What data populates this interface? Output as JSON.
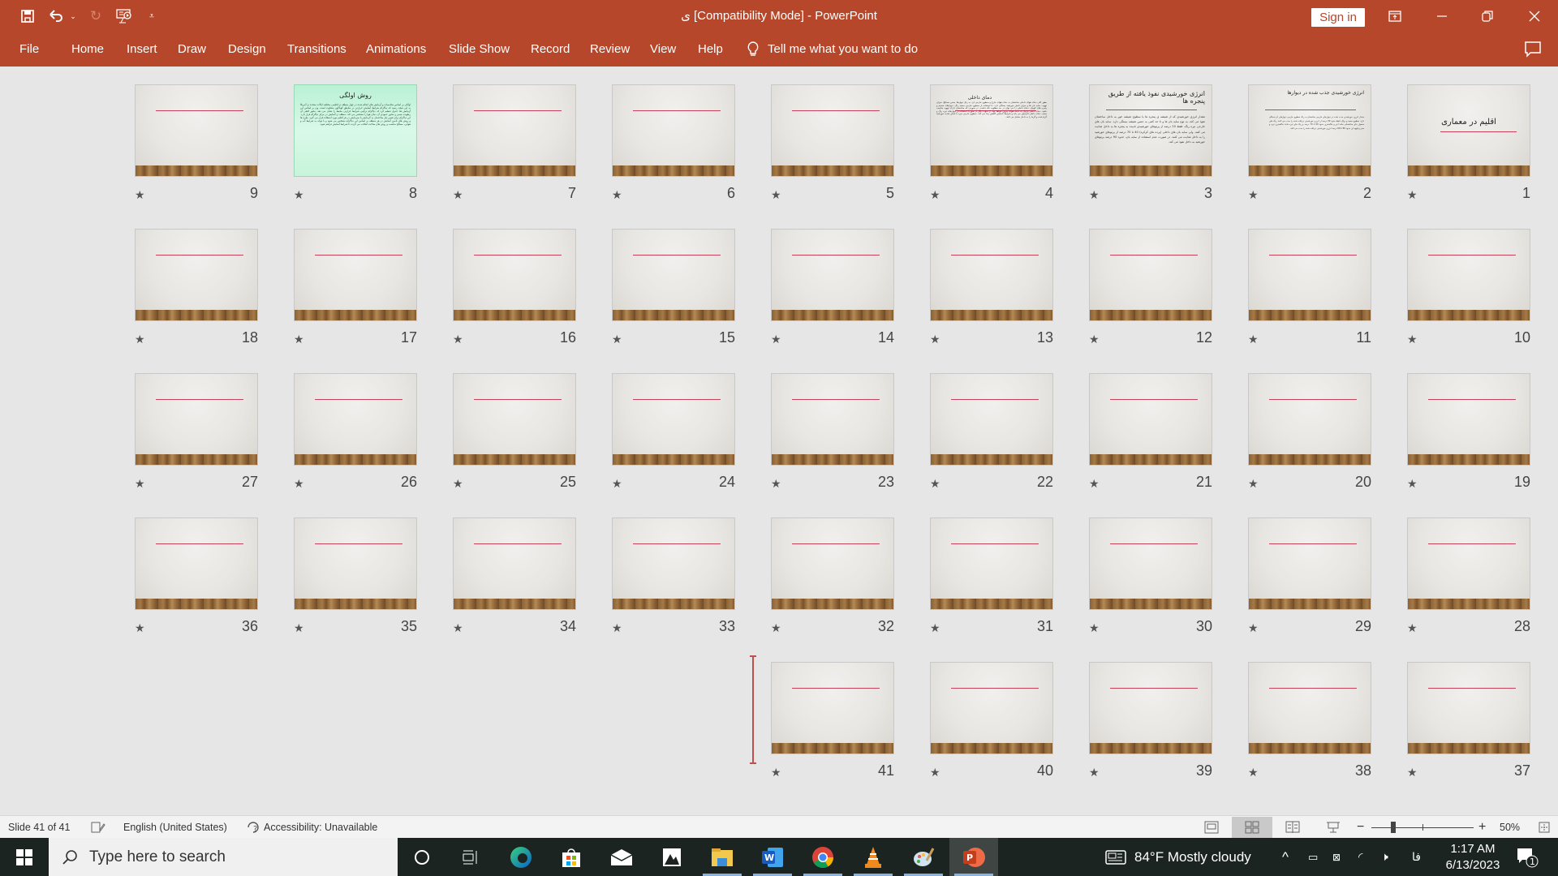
{
  "app": {
    "title": "ی [Compatibility Mode]  -  PowerPoint",
    "sign_in": "Sign in",
    "colors": {
      "brand": "#b7472a",
      "accent_line": "#c4425a",
      "selected_view": "#c9c9c9"
    }
  },
  "quick_access": {
    "icons": [
      "save-icon",
      "undo-icon",
      "undo-dropdown-icon",
      "redo-icon",
      "start-from-beginning-icon",
      "customize-qat-icon"
    ]
  },
  "window_controls": [
    "ribbon-display-options-icon",
    "minimize-icon",
    "restore-icon",
    "close-icon"
  ],
  "ribbon": {
    "tabs": [
      "File",
      "Home",
      "Insert",
      "Draw",
      "Design",
      "Transitions",
      "Animations",
      "Slide Show",
      "Record",
      "Review",
      "View",
      "Help"
    ],
    "tell_me": "Tell me what you want to do"
  },
  "slides": [
    {
      "number": "1",
      "kind": "title",
      "title": "اقلیم در معماری"
    },
    {
      "number": "2",
      "kind": "text",
      "title": "انرژی خورشیدی جذب شده در دیوارها",
      "body": "مقدار انرژی خورشیدی جذب شده در دیوارهای خارجی ساختمان به رنگ سطوح خارجی دیوارهای آن بستگی دارد. سطوح سفید و براق، فقط حدود 20 درصد از انرژی خورشیدی دریافت شده را جذب می کنند. رنگ های معمول بنای ساختمانی مانند آجر و خاکستری حدود 60 تا 70 درصد و رنگ های تیره مانند خاکستری تیره و سبز و قهوه ای حدود 80 تا 90 درصد انرژی خورشیدی دریافت شده را جذب می کنند."
    },
    {
      "number": "3",
      "kind": "text",
      "title": "انرژی خورشیدی نفوذ یافته از طریق پنجره ها",
      "body": "مقدار انرژی خورشیدی که از شیشه ی پنجره ها یا سطوح شیشه خور به داخل ساختمان نفوذ می کند، به نوع سایه بان ها و تا حد کمی به جنس شیشه بستگی دارد. سایه بان های خارجی تیره رنگ، فقط 10 درصد از پرتوهای خورشیدی تابیده به پنجره ها به داخل هدایت می کنند. ولی سایه بان های داخلی (پرده های کرکره) 40 تا 70 درصد از پرتوهای خورشید را به داخل هدایت می کنند. در صورت عدم استفاده از سایه بان، حدود 90 درصد پرتوهای خورشید به داخل نفوذ می کند."
    },
    {
      "number": "4",
      "kind": "dense",
      "title": "دمای داخلی",
      "body": "بطور کلی دمای هوای داخلی ساختمان به دمای هوای خارج و سطوح خارجی آن، به رنگ دیوارها، جنس مصالح، میزان تهویه، سایه بان ها و میزان تابش خورشید بستگی دارد. با استفاده از سطوح خارجی سفید رنگ، دیوارهای ضخیم و پنجره های کوچک، دمای داخلی را می توان در حد مطلوب نگه داشت. در صورتی که ساختمان دارای تهویه مناسب باشد، دمای داخلی نزدیک به دمای هوای بیرون خواهد بود. از سوی دیگر در صورت استفاده از دیوارهای تیره رنگ و سبک، دمای داخلی افزایش می یابد و شرایط آسایش کاهش پیدا می کند. سطوح خارجی تیره با تابش شدید خورشید گرم شده و گرما را به داخل منتقل می کنند."
    },
    {
      "number": "5",
      "kind": "blank"
    },
    {
      "number": "6",
      "kind": "blank"
    },
    {
      "number": "7",
      "kind": "blank"
    },
    {
      "number": "8",
      "kind": "green",
      "title": "روش اولگی",
      "body": "اولگی بر اساس محاسبات و آزمایش های انجام شده در چهار منطقه ی اقلیمی مختلف ایالات متحده ی آمریکا به این نتیجه رسید که دیاگرام شرایط آسایش حرارتی در مناطق گوناگون متفاوت است. وی بر اساس این آزمایش ها، جدول تنظیم کرد که دیاگرام ترکیبی شرایط حرارتی محیط را نشان می دهد. محور افقی آن رطوبت نسبی و محور عمودی آن دمای هوا را مشخص می کند. منطقه ی آسایش در مرکز دیاگرام قرار دارد. این دیاگرام برای تعیین نیاز ساختمان به گرمایش یا سرمایش در هر اقلیم مورد استفاده قرار می گیرد. طرح ها و روش های تامین آسایش در هر منطقه بر اساس این دیاگرام مشخص می شود و با توجه به شرایط آب و هوایی، مصالح مناسب و روش های ساخت انتخاب می گردند تا شرایط آسایش فراهم شود."
    },
    {
      "number": "9",
      "kind": "blank"
    },
    {
      "number": "10",
      "kind": "blank"
    },
    {
      "number": "11",
      "kind": "blank"
    },
    {
      "number": "12",
      "kind": "blank"
    },
    {
      "number": "13",
      "kind": "blank"
    },
    {
      "number": "14",
      "kind": "blank"
    },
    {
      "number": "15",
      "kind": "blank"
    },
    {
      "number": "16",
      "kind": "blank"
    },
    {
      "number": "17",
      "kind": "blank"
    },
    {
      "number": "18",
      "kind": "blank"
    },
    {
      "number": "19",
      "kind": "blank"
    },
    {
      "number": "20",
      "kind": "blank"
    },
    {
      "number": "21",
      "kind": "blank"
    },
    {
      "number": "22",
      "kind": "blank"
    },
    {
      "number": "23",
      "kind": "blank"
    },
    {
      "number": "24",
      "kind": "blank"
    },
    {
      "number": "25",
      "kind": "blank"
    },
    {
      "number": "26",
      "kind": "blank"
    },
    {
      "number": "27",
      "kind": "blank"
    },
    {
      "number": "28",
      "kind": "blank"
    },
    {
      "number": "29",
      "kind": "blank"
    },
    {
      "number": "30",
      "kind": "blank"
    },
    {
      "number": "31",
      "kind": "blank"
    },
    {
      "number": "32",
      "kind": "blank"
    },
    {
      "number": "33",
      "kind": "blank"
    },
    {
      "number": "34",
      "kind": "blank"
    },
    {
      "number": "35",
      "kind": "blank"
    },
    {
      "number": "36",
      "kind": "blank"
    },
    {
      "number": "37",
      "kind": "blank"
    },
    {
      "number": "38",
      "kind": "blank"
    },
    {
      "number": "39",
      "kind": "blank"
    },
    {
      "number": "40",
      "kind": "blank"
    },
    {
      "number": "41",
      "kind": "blank"
    }
  ],
  "status_bar": {
    "slide_info": "Slide 41 of 41",
    "language": "English (United States)",
    "accessibility": "Accessibility: Unavailable",
    "zoom_percent": "50%",
    "zoom_level": 50,
    "active_view": "slide-sorter"
  },
  "taskbar": {
    "search_placeholder": "Type here to search",
    "apps": [
      "cortana",
      "task-view",
      "edge",
      "microsoft-store",
      "mail",
      "photos",
      "file-explorer",
      "word",
      "chrome",
      "vlc",
      "paint",
      "powerpoint"
    ],
    "weather": "84°F  Mostly cloudy",
    "input_lang": "فا",
    "time": "1:17 AM",
    "date": "6/13/2023",
    "notification_count": "1"
  }
}
